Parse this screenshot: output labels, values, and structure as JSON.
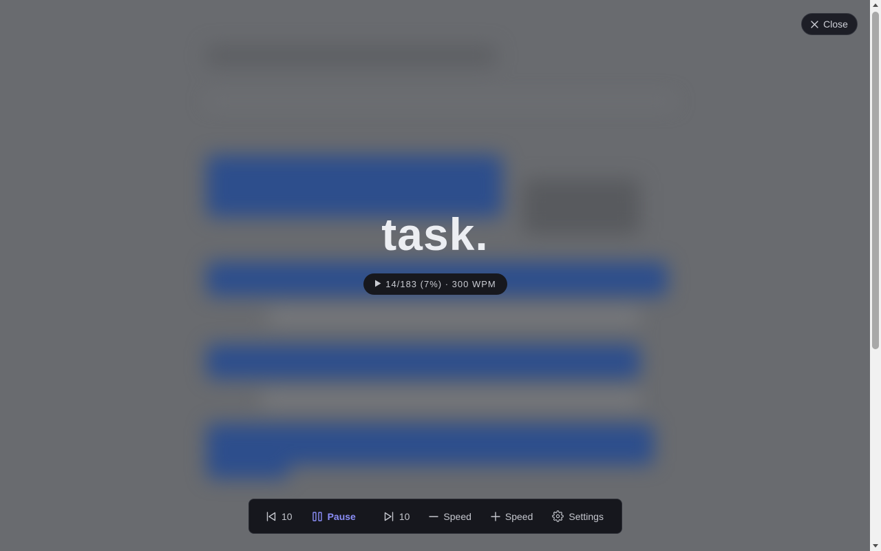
{
  "reader": {
    "current_word": "task.",
    "status": {
      "state_icon": "play-icon",
      "text": "14/183 (7%) · 300 WPM",
      "word_index": 14,
      "word_total": 183,
      "progress_percent": 7,
      "wpm": 300
    }
  },
  "close_button": {
    "label": "Close",
    "icon": "close-icon"
  },
  "controls": {
    "back": {
      "icon": "skip-back-icon",
      "label": "10"
    },
    "pause": {
      "icon": "pause-icon",
      "label": "Pause"
    },
    "forward": {
      "icon": "skip-forward-icon",
      "label": "10"
    },
    "speed_down": {
      "icon": "minus-icon",
      "label": "Speed"
    },
    "speed_up": {
      "icon": "plus-icon",
      "label": "Speed"
    },
    "settings": {
      "icon": "gear-icon",
      "label": "Settings"
    }
  },
  "colors": {
    "overlay": "#696b6f",
    "accent": "#8b8ef7",
    "bar": "#16171d"
  }
}
